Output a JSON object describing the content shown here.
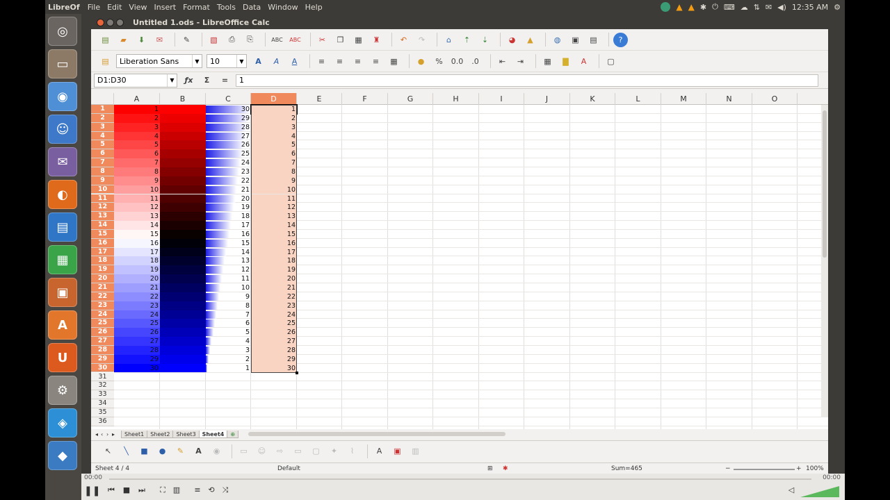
{
  "top_panel": {
    "app_name": "LibreOf",
    "menus": [
      "File",
      "Edit",
      "View",
      "Insert",
      "Format",
      "Tools",
      "Data",
      "Window",
      "Help"
    ],
    "clock": "12:35 AM"
  },
  "window": {
    "title": "Untitled 1.ods - LibreOffice Calc"
  },
  "formatting": {
    "font_name": "Liberation Sans",
    "font_size": "10"
  },
  "formula_bar": {
    "name_box": "D1:D30",
    "function_wizard": "ƒx",
    "sum": "Σ",
    "equals": "=",
    "content": "1"
  },
  "columns": [
    "A",
    "B",
    "C",
    "D",
    "E",
    "F",
    "G",
    "H",
    "I",
    "J",
    "K",
    "L",
    "M",
    "N",
    "O"
  ],
  "selected_column": "D",
  "rows": [
    "1",
    "2",
    "3",
    "4",
    "5",
    "6",
    "7",
    "8",
    "9",
    "10",
    "11",
    "12",
    "13",
    "14",
    "15",
    "16",
    "17",
    "18",
    "19",
    "20",
    "21",
    "22",
    "23",
    "24",
    "25",
    "26",
    "27",
    "28",
    "29",
    "30",
    "31",
    "32",
    "33",
    "34",
    "35",
    "36"
  ],
  "col_a": [
    "1",
    "2",
    "3",
    "4",
    "5",
    "6",
    "7",
    "8",
    "9",
    "10",
    "11",
    "12",
    "13",
    "14",
    "15",
    "16",
    "17",
    "18",
    "19",
    "20",
    "21",
    "22",
    "23",
    "24",
    "25",
    "26",
    "27",
    "28",
    "29",
    "30"
  ],
  "col_c": [
    "30",
    "29",
    "28",
    "27",
    "26",
    "25",
    "24",
    "23",
    "22",
    "21",
    "20",
    "19",
    "18",
    "17",
    "16",
    "15",
    "14",
    "13",
    "12",
    "11",
    "10",
    "9",
    "8",
    "7",
    "6",
    "5",
    "4",
    "3",
    "2",
    "1"
  ],
  "col_d": [
    "1",
    "2",
    "3",
    "4",
    "5",
    "6",
    "7",
    "8",
    "9",
    "10",
    "11",
    "12",
    "13",
    "14",
    "15",
    "16",
    "17",
    "18",
    "19",
    "20",
    "21",
    "22",
    "23",
    "24",
    "25",
    "26",
    "27",
    "28",
    "29",
    "30"
  ],
  "sheet_tabs": [
    "Sheet1",
    "Sheet2",
    "Sheet3",
    "Sheet4"
  ],
  "active_sheet": "Sheet4",
  "status": {
    "sheet": "Sheet 4 / 4",
    "page_style": "Default",
    "sum": "Sum=465",
    "zoom": "100%"
  },
  "media": {
    "time_left": "00:00",
    "time_right": "00:00"
  },
  "colors": {
    "selection_header": "#f08a5d",
    "selection_fill": "#fad4c3",
    "panel_bg": "#3c3b37"
  }
}
